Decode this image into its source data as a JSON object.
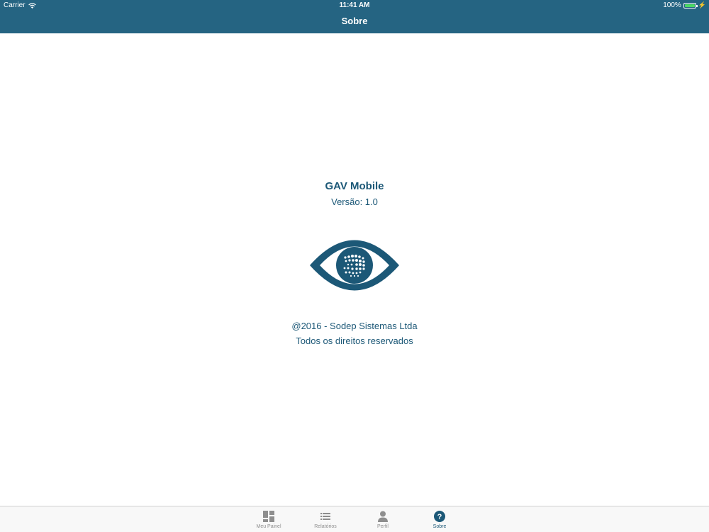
{
  "status_bar": {
    "carrier": "Carrier",
    "time": "11:41 AM",
    "battery": "100%"
  },
  "nav": {
    "title": "Sobre"
  },
  "about": {
    "app_name": "GAV Mobile",
    "version": "Versão: 1.0",
    "copyright": "@2016 - Sodep Sistemas Ltda",
    "rights": "Todos os direitos reservados"
  },
  "tabs": [
    {
      "label": "Meu Painel",
      "icon": "dashboard-icon",
      "active": false
    },
    {
      "label": "Relatórios",
      "icon": "list-icon",
      "active": false
    },
    {
      "label": "Perfil",
      "icon": "person-icon",
      "active": false
    },
    {
      "label": "Sobre",
      "icon": "question-icon",
      "active": true
    }
  ],
  "colors": {
    "header": "#256482",
    "brand": "#1c5877",
    "tab_inactive": "#8e8e8e",
    "battery": "#4cd964"
  }
}
